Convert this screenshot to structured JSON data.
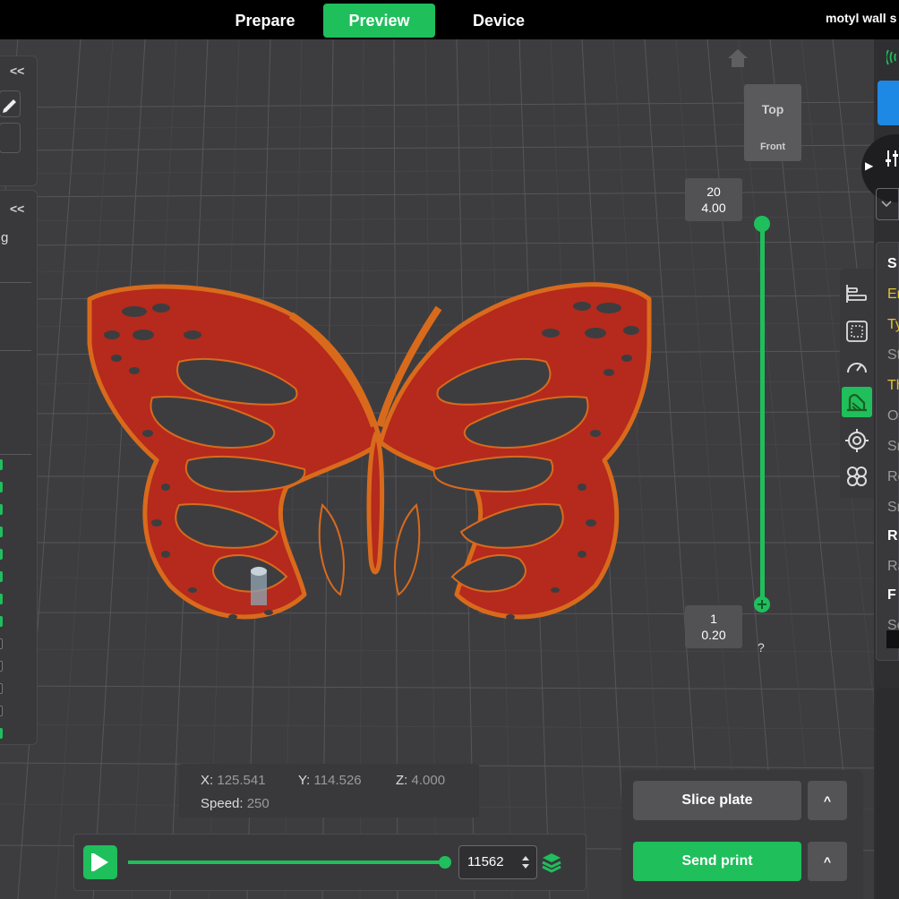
{
  "header": {
    "tabs": [
      {
        "label": "Prepare",
        "active": false
      },
      {
        "label": "Preview",
        "active": true
      },
      {
        "label": "Device",
        "active": false
      }
    ],
    "project_title": "motyl wall s"
  },
  "left_panel": {
    "collapse_label": "<<",
    "collapse_label_2": "<<",
    "partial_label": "g",
    "checkboxes": [
      true,
      true,
      true,
      true,
      true,
      true,
      true,
      true,
      false,
      false,
      false,
      false,
      true
    ]
  },
  "view_cube": {
    "top_label": "Top",
    "front_label": "Front"
  },
  "layer_slider": {
    "top_layer": "20",
    "top_height": "4.00",
    "bottom_layer": "1",
    "bottom_height": "0.20",
    "help_label": "?"
  },
  "right_panel": {
    "letters": [
      {
        "text": "S",
        "color": "#ffffff",
        "bold": true
      },
      {
        "text": "Er",
        "color": "#e6c229",
        "bold": false
      },
      {
        "text": "Ty",
        "color": "#e6c229",
        "bold": false
      },
      {
        "text": "St",
        "color": "#9a9a9a",
        "bold": false
      },
      {
        "text": "Th",
        "color": "#e6c229",
        "bold": false
      },
      {
        "text": "O",
        "color": "#9a9a9a",
        "bold": false
      },
      {
        "text": "Sr",
        "color": "#9a9a9a",
        "bold": false
      },
      {
        "text": "Re",
        "color": "#9a9a9a",
        "bold": false
      },
      {
        "text": "Sr",
        "color": "#9a9a9a",
        "bold": false
      },
      {
        "text": "R",
        "color": "#ffffff",
        "bold": true
      },
      {
        "text": "Ra",
        "color": "#9a9a9a",
        "bold": false
      },
      {
        "text": "F",
        "color": "#ffffff",
        "bold": true
      },
      {
        "text": "Se",
        "color": "#9a9a9a",
        "bold": false
      }
    ]
  },
  "coordinates": {
    "x_label": "X:",
    "x_value": "125.541",
    "y_label": "Y:",
    "y_value": "114.526",
    "z_label": "Z:",
    "z_value": "4.000",
    "speed_label": "Speed:",
    "speed_value": "250"
  },
  "playback": {
    "layer_move_value": "11562",
    "progress": 1.0
  },
  "print": {
    "slice_label": "Slice plate",
    "send_label": "Send print",
    "caret": "^"
  },
  "colors": {
    "accent": "#1fbf5c",
    "model_fill": "#b52a1c",
    "model_edge": "#d96a1c",
    "background": "#3d3d40"
  }
}
